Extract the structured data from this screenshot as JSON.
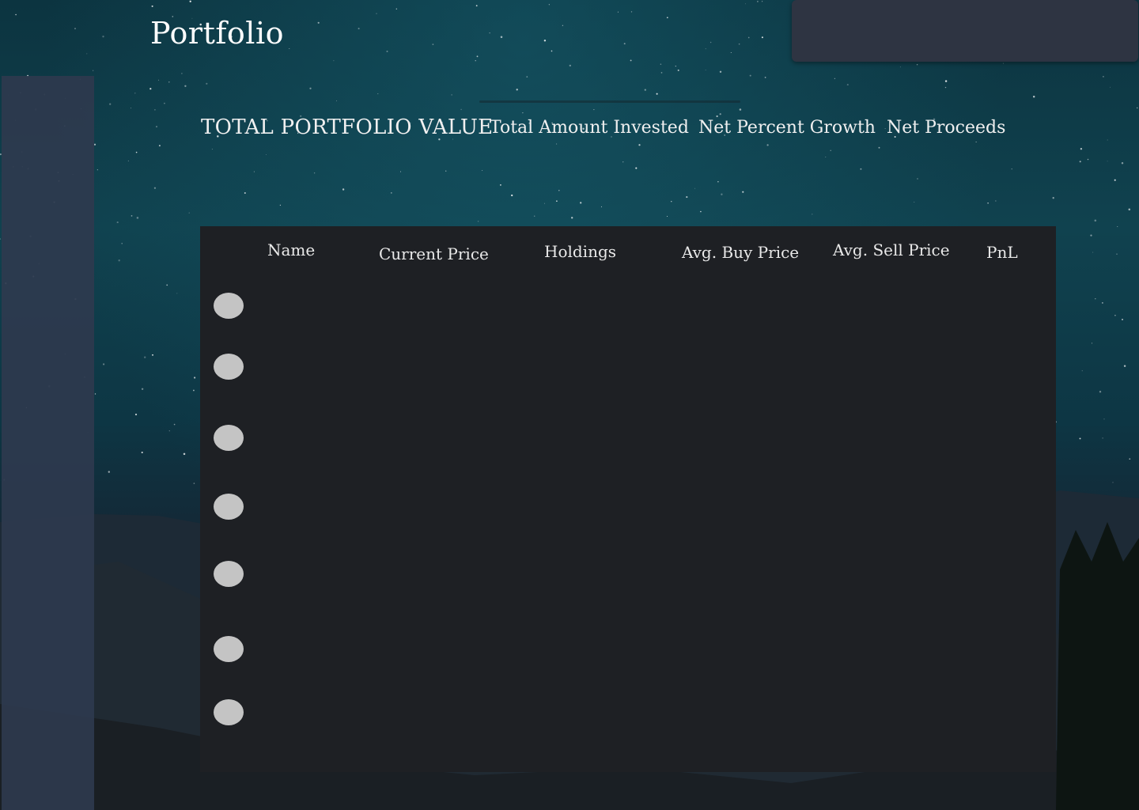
{
  "page": {
    "title": "Portfolio"
  },
  "summary": {
    "total_portfolio_value_label": "TOTAL PORTFOLIO VALUE",
    "total_amount_invested_label": "Total Amount Invested",
    "net_percent_growth_label": "Net Percent Growth",
    "net_proceeds_label": "Net Proceeds"
  },
  "holdings_table": {
    "columns": [
      "Name",
      "Current Price",
      "Holdings",
      "Avg. Buy Price",
      "Avg. Sell Price",
      "PnL"
    ],
    "row_count": 7
  },
  "colors": {
    "table_background": "#1e2024",
    "sidebar_background": "#2e3a4e",
    "top_panel_background": "#2e3442",
    "avatar_placeholder": "#c4c4c4",
    "text": "#f2f2f2"
  }
}
